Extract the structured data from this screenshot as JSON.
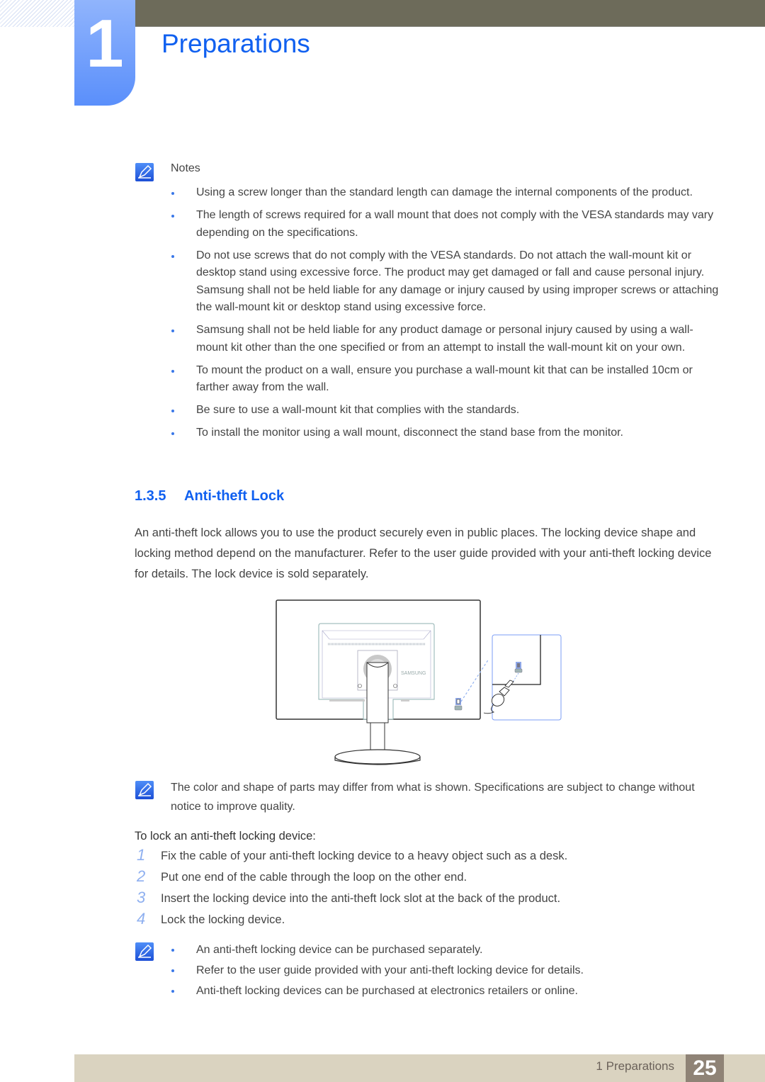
{
  "header": {
    "chapter_number": "1",
    "chapter_title": "Preparations"
  },
  "notes": {
    "icon": "note-pencil-icon",
    "label": "Notes",
    "items": [
      "Using a screw longer than the standard length can damage the internal components of the product.",
      "The length of screws required for a wall mount that does not comply with the VESA standards may vary depending on the specifications.",
      "Do not use screws that do not comply with the VESA standards. Do not attach the wall-mount kit or desktop stand using excessive force. The product may get damaged or fall and cause personal injury. Samsung shall not be held liable for any damage or injury caused by using improper screws or attaching the wall-mount kit or desktop stand using excessive force.",
      "Samsung shall not be held liable for any product damage or personal injury caused by using a wall-mount kit other than the one specified or from an attempt to install the wall-mount kit on your own.",
      "To mount the product on a wall, ensure you purchase a wall-mount kit that can be installed 10cm or farther away from the wall.",
      "Be sure to use a wall-mount kit that complies with the standards.",
      "To install the monitor using a wall mount, disconnect the stand base from the monitor."
    ]
  },
  "section": {
    "number": "1.3.5",
    "title": "Anti-theft Lock",
    "intro": "An anti-theft lock allows you to use the product securely even in public places. The locking device shape and locking method depend on the manufacturer. Refer to the user guide provided with your anti-theft locking device for details. The lock device is sold separately."
  },
  "figure": {
    "description": "Rear view of monitor with anti-theft lock slot detail",
    "brand_text": "SAMSUNG"
  },
  "caption": "The color and shape of parts may differ from what is shown. Specifications are subject to change without notice to improve quality.",
  "procedure": {
    "heading": "To lock an anti-theft locking device:",
    "steps": [
      {
        "num": "1",
        "text": "Fix the cable of your anti-theft locking device to a heavy object such as a desk."
      },
      {
        "num": "2",
        "text": "Put one end of the cable through the loop on the other end."
      },
      {
        "num": "3",
        "text": "Insert the locking device into the anti-theft lock slot at the back of the product."
      },
      {
        "num": "4",
        "text": "Lock the locking device."
      }
    ]
  },
  "final_notes": [
    "An anti-theft locking device can be purchased separately.",
    "Refer to the user guide provided with your anti-theft locking device for details.",
    "Anti-theft locking devices can be purchased at electronics retailers or online."
  ],
  "footer": {
    "label": "1 Preparations",
    "page_number": "25"
  },
  "colors": {
    "accent_blue": "#1060f0",
    "header_bar": "#6d6b5a",
    "footer_bar": "#dad3c0",
    "page_badge": "#8f8376"
  }
}
